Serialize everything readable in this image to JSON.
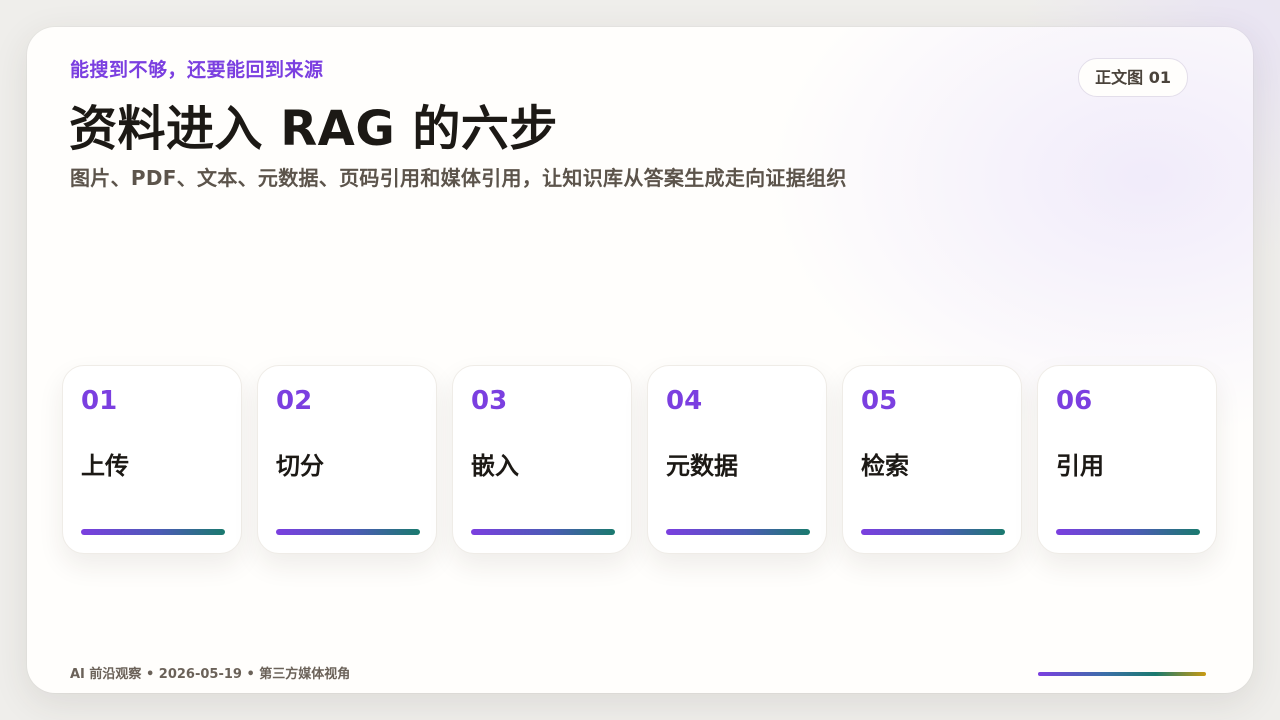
{
  "header": {
    "kicker": "能搜到不够，还要能回到来源",
    "title": "资料进入 RAG 的六步",
    "subtitle": "图片、PDF、文本、元数据、页码引用和媒体引用，让知识库从答案生成走向证据组织",
    "badge": "正文图 01"
  },
  "steps": [
    {
      "number": "01",
      "label": "上传"
    },
    {
      "number": "02",
      "label": "切分"
    },
    {
      "number": "03",
      "label": "嵌入"
    },
    {
      "number": "04",
      "label": "元数据"
    },
    {
      "number": "05",
      "label": "检索"
    },
    {
      "number": "06",
      "label": "引用"
    }
  ],
  "footer": {
    "text": "AI 前沿观察 • 2026-05-19 • 第三方媒体视角"
  },
  "colors": {
    "accent": "#7b3fe0",
    "teal": "#1a7a6e",
    "gold": "#c99a12",
    "text_dark": "#1c1915",
    "text_muted": "#5c544b"
  }
}
